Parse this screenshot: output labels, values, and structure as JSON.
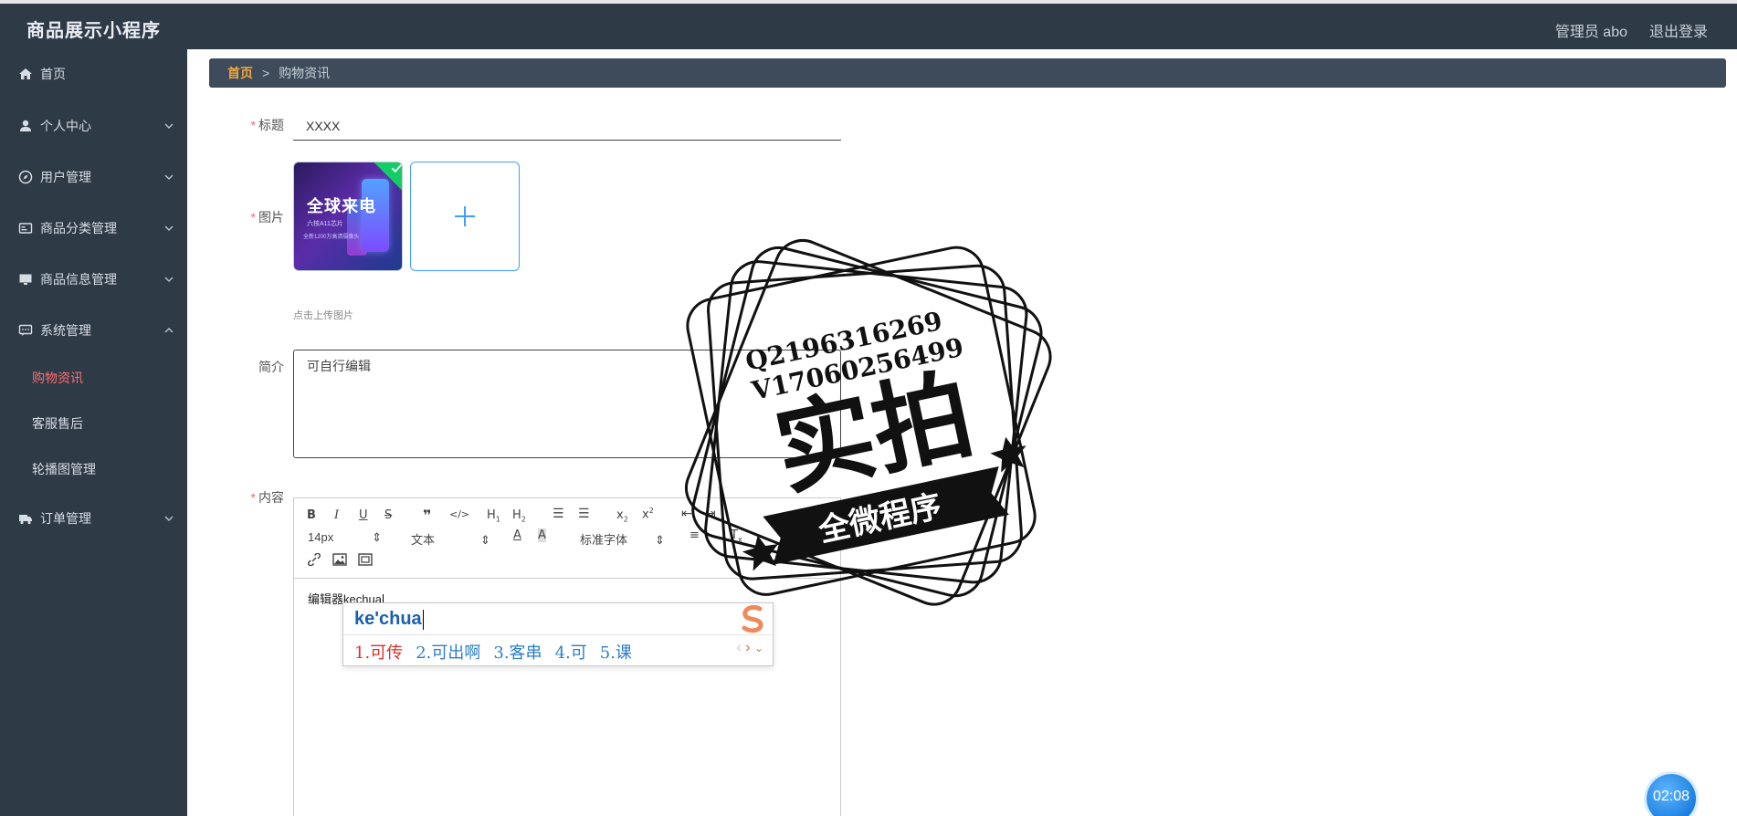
{
  "header": {
    "app_title": "商品展示小程序",
    "user_label": "管理员 abo",
    "logout_label": "退出登录"
  },
  "sidebar": {
    "items": [
      {
        "label": "首页",
        "icon": "home-icon"
      },
      {
        "label": "个人中心",
        "icon": "user-icon"
      },
      {
        "label": "用户管理",
        "icon": "compass-icon"
      },
      {
        "label": "商品分类管理",
        "icon": "card-icon"
      },
      {
        "label": "商品信息管理",
        "icon": "monitor-icon"
      },
      {
        "label": "系统管理",
        "icon": "chat-icon"
      },
      {
        "label": "订单管理",
        "icon": "truck-icon"
      }
    ],
    "sub_items": [
      {
        "label": "购物资讯",
        "active": true
      },
      {
        "label": "客服售后",
        "active": false
      },
      {
        "label": "轮播图管理",
        "active": false
      }
    ]
  },
  "breadcrumb": {
    "home": "首页",
    "separator": ">",
    "current": "购物资讯"
  },
  "form": {
    "title_label": "标题",
    "title_value": "XXXX",
    "image_label": "图片",
    "upload_hint": "点击上传图片",
    "summary_label": "简介",
    "summary_value": "可自行编辑",
    "content_label": "内容",
    "thumb_text": {
      "line1": "全球来电",
      "line2": "六核A11芯片",
      "line3": "全新1200万高清摄像头"
    }
  },
  "editor": {
    "font_size": "14px",
    "paragraph": "文本",
    "font_family": "标准字体",
    "content": "编辑器kechua"
  },
  "ime": {
    "input": "ke'chua",
    "candidates": [
      "1.可传",
      "2.可出啊",
      "3.客串",
      "4.可",
      "5.课"
    ]
  },
  "stamp": {
    "line1": "Q2196316269",
    "line2": "V17060256499",
    "big": "实拍",
    "banner": "全微程序"
  },
  "timer": "02:08",
  "colors": {
    "sidebar_bg": "#2f3a47",
    "active": "#ff6b6b",
    "accent": "#409eff",
    "breadcrumb_home": "#f0a640",
    "required": "#f56c6c"
  }
}
